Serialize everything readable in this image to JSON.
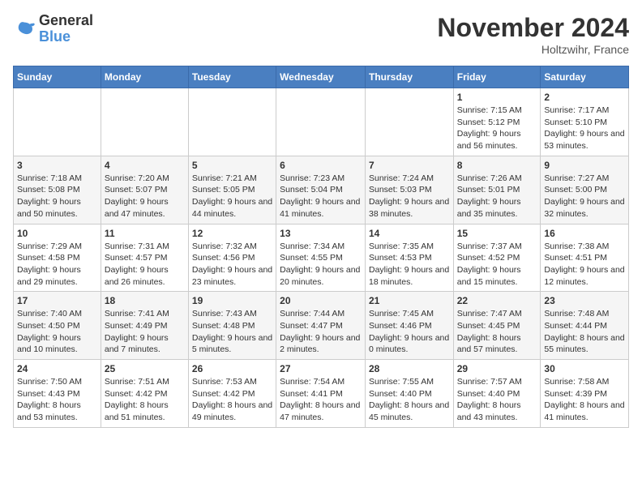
{
  "header": {
    "logo_general": "General",
    "logo_blue": "Blue",
    "month_title": "November 2024",
    "location": "Holtzwihr, France"
  },
  "weekdays": [
    "Sunday",
    "Monday",
    "Tuesday",
    "Wednesday",
    "Thursday",
    "Friday",
    "Saturday"
  ],
  "weeks": [
    [
      {
        "day": "",
        "info": ""
      },
      {
        "day": "",
        "info": ""
      },
      {
        "day": "",
        "info": ""
      },
      {
        "day": "",
        "info": ""
      },
      {
        "day": "",
        "info": ""
      },
      {
        "day": "1",
        "info": "Sunrise: 7:15 AM\nSunset: 5:12 PM\nDaylight: 9 hours and 56 minutes."
      },
      {
        "day": "2",
        "info": "Sunrise: 7:17 AM\nSunset: 5:10 PM\nDaylight: 9 hours and 53 minutes."
      }
    ],
    [
      {
        "day": "3",
        "info": "Sunrise: 7:18 AM\nSunset: 5:08 PM\nDaylight: 9 hours and 50 minutes."
      },
      {
        "day": "4",
        "info": "Sunrise: 7:20 AM\nSunset: 5:07 PM\nDaylight: 9 hours and 47 minutes."
      },
      {
        "day": "5",
        "info": "Sunrise: 7:21 AM\nSunset: 5:05 PM\nDaylight: 9 hours and 44 minutes."
      },
      {
        "day": "6",
        "info": "Sunrise: 7:23 AM\nSunset: 5:04 PM\nDaylight: 9 hours and 41 minutes."
      },
      {
        "day": "7",
        "info": "Sunrise: 7:24 AM\nSunset: 5:03 PM\nDaylight: 9 hours and 38 minutes."
      },
      {
        "day": "8",
        "info": "Sunrise: 7:26 AM\nSunset: 5:01 PM\nDaylight: 9 hours and 35 minutes."
      },
      {
        "day": "9",
        "info": "Sunrise: 7:27 AM\nSunset: 5:00 PM\nDaylight: 9 hours and 32 minutes."
      }
    ],
    [
      {
        "day": "10",
        "info": "Sunrise: 7:29 AM\nSunset: 4:58 PM\nDaylight: 9 hours and 29 minutes."
      },
      {
        "day": "11",
        "info": "Sunrise: 7:31 AM\nSunset: 4:57 PM\nDaylight: 9 hours and 26 minutes."
      },
      {
        "day": "12",
        "info": "Sunrise: 7:32 AM\nSunset: 4:56 PM\nDaylight: 9 hours and 23 minutes."
      },
      {
        "day": "13",
        "info": "Sunrise: 7:34 AM\nSunset: 4:55 PM\nDaylight: 9 hours and 20 minutes."
      },
      {
        "day": "14",
        "info": "Sunrise: 7:35 AM\nSunset: 4:53 PM\nDaylight: 9 hours and 18 minutes."
      },
      {
        "day": "15",
        "info": "Sunrise: 7:37 AM\nSunset: 4:52 PM\nDaylight: 9 hours and 15 minutes."
      },
      {
        "day": "16",
        "info": "Sunrise: 7:38 AM\nSunset: 4:51 PM\nDaylight: 9 hours and 12 minutes."
      }
    ],
    [
      {
        "day": "17",
        "info": "Sunrise: 7:40 AM\nSunset: 4:50 PM\nDaylight: 9 hours and 10 minutes."
      },
      {
        "day": "18",
        "info": "Sunrise: 7:41 AM\nSunset: 4:49 PM\nDaylight: 9 hours and 7 minutes."
      },
      {
        "day": "19",
        "info": "Sunrise: 7:43 AM\nSunset: 4:48 PM\nDaylight: 9 hours and 5 minutes."
      },
      {
        "day": "20",
        "info": "Sunrise: 7:44 AM\nSunset: 4:47 PM\nDaylight: 9 hours and 2 minutes."
      },
      {
        "day": "21",
        "info": "Sunrise: 7:45 AM\nSunset: 4:46 PM\nDaylight: 9 hours and 0 minutes."
      },
      {
        "day": "22",
        "info": "Sunrise: 7:47 AM\nSunset: 4:45 PM\nDaylight: 8 hours and 57 minutes."
      },
      {
        "day": "23",
        "info": "Sunrise: 7:48 AM\nSunset: 4:44 PM\nDaylight: 8 hours and 55 minutes."
      }
    ],
    [
      {
        "day": "24",
        "info": "Sunrise: 7:50 AM\nSunset: 4:43 PM\nDaylight: 8 hours and 53 minutes."
      },
      {
        "day": "25",
        "info": "Sunrise: 7:51 AM\nSunset: 4:42 PM\nDaylight: 8 hours and 51 minutes."
      },
      {
        "day": "26",
        "info": "Sunrise: 7:53 AM\nSunset: 4:42 PM\nDaylight: 8 hours and 49 minutes."
      },
      {
        "day": "27",
        "info": "Sunrise: 7:54 AM\nSunset: 4:41 PM\nDaylight: 8 hours and 47 minutes."
      },
      {
        "day": "28",
        "info": "Sunrise: 7:55 AM\nSunset: 4:40 PM\nDaylight: 8 hours and 45 minutes."
      },
      {
        "day": "29",
        "info": "Sunrise: 7:57 AM\nSunset: 4:40 PM\nDaylight: 8 hours and 43 minutes."
      },
      {
        "day": "30",
        "info": "Sunrise: 7:58 AM\nSunset: 4:39 PM\nDaylight: 8 hours and 41 minutes."
      }
    ]
  ]
}
